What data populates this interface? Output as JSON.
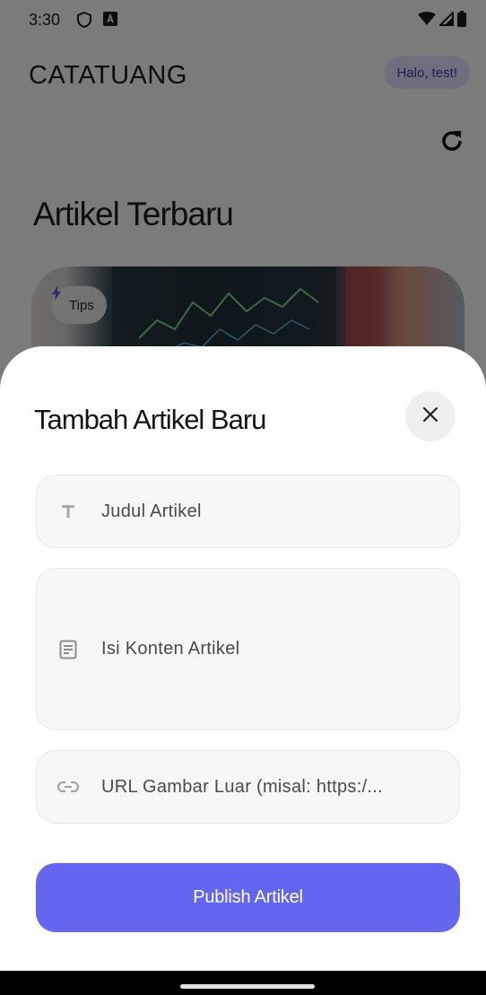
{
  "status_bar": {
    "time": "3:30",
    "icons": [
      "shield-icon",
      "notification-a-icon",
      "wifi-icon",
      "signal-icon",
      "battery-icon"
    ]
  },
  "header": {
    "app_title": "CATATUANG",
    "greeting": "Halo, test!",
    "refresh_icon": "refresh-icon"
  },
  "main": {
    "section_title": "Artikel Terbaru",
    "featured_article": {
      "tag_label": "Tips",
      "tag_icon": "lightning-icon"
    }
  },
  "sheet": {
    "title": "Tambah Artikel Baru",
    "close_icon": "close-icon",
    "fields": {
      "title": {
        "placeholder": "Judul Artikel",
        "icon": "text-icon"
      },
      "content": {
        "placeholder": "Isi Konten Artikel",
        "icon": "article-icon"
      },
      "image_url": {
        "placeholder": "URL Gambar Luar (misal: https:/...",
        "icon": "link-icon"
      }
    },
    "publish_label": "Publish Artikel"
  },
  "colors": {
    "accent": "#6466f0",
    "badge_bg": "#dcdcff",
    "badge_text": "#3b3b9f"
  }
}
